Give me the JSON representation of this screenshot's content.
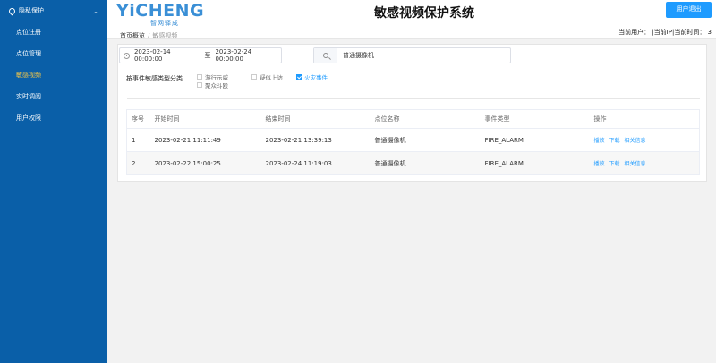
{
  "sidebar": {
    "group": {
      "label": "隐私保护"
    },
    "items": [
      {
        "label": "点位注册",
        "active": false
      },
      {
        "label": "点位管理",
        "active": false
      },
      {
        "label": "敏感视频",
        "active": true
      },
      {
        "label": "实时调阅",
        "active": false
      },
      {
        "label": "用户权限",
        "active": false
      }
    ]
  },
  "header": {
    "logo_main": "YiCHENG",
    "logo_sub": "智网驿成",
    "title": "敏感视频保护系统",
    "logout_label": "用户退出",
    "userline": "当前用户： |当前IP|当前时间：  3"
  },
  "breadcrumb": {
    "home": "首页概览",
    "sep": "/",
    "current": "敏感视频"
  },
  "filters": {
    "date_start": "2023-02-14 00:00:00",
    "date_sep": "至",
    "date_end": "2023-02-24 00:00:00",
    "search_value": "普通摄像机",
    "category_label": "按事件敏感类型分类",
    "checkboxes": [
      {
        "label": "游行示威",
        "checked": false
      },
      {
        "label": "疑似上访",
        "checked": false
      },
      {
        "label": "火灾事件",
        "checked": true
      },
      {
        "label": "聚众斗殴",
        "checked": false
      }
    ]
  },
  "table": {
    "headers": [
      "序号",
      "开始时间",
      "结束时间",
      "点位名称",
      "事件类型",
      "操作"
    ],
    "rows": [
      {
        "index": "1",
        "start": "2023-02-21 11:11:49",
        "end": "2023-02-21 13:39:13",
        "point": "普通摄像机",
        "event": "FIRE_ALARM",
        "ops": [
          "播放",
          "下载",
          "相关信息"
        ]
      },
      {
        "index": "2",
        "start": "2023-02-22 15:00:25",
        "end": "2023-02-24 11:19:03",
        "point": "普通摄像机",
        "event": "FIRE_ALARM",
        "ops": [
          "播放",
          "下载",
          "相关信息"
        ]
      }
    ]
  },
  "colors": {
    "sidebar_bg": "#0a5fa8",
    "accent": "#1e9bff",
    "active_menu": "#f2c649"
  }
}
